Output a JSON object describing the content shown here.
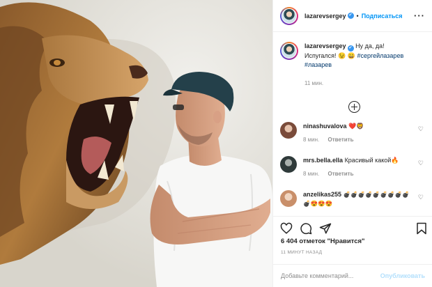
{
  "header": {
    "username": "lazarevsergey",
    "verified_mark": "✔",
    "separator": "•",
    "follow_label": "Подписаться",
    "more_label": "···"
  },
  "caption": {
    "username": "lazarevsergey",
    "text_line1": "Ну да, да!",
    "text_line2": "Испугался!",
    "emojis": "😉 😄",
    "hashtag1": "#сергейлазарев",
    "hashtag2": "#лазарев",
    "time": "11 мин."
  },
  "comments": [
    {
      "username": "ninashuvalova",
      "text": "❤️🦁",
      "time": "8 мин.",
      "reply_label": "Ответить",
      "avatar_color": "#7a4b3a"
    },
    {
      "username": "mrs.bella.ella",
      "text": "Красивый какой🔥",
      "time": "8 мин.",
      "reply_label": "Ответить",
      "avatar_color": "#2f3a3a"
    },
    {
      "username": "anzelikas255",
      "text": "💣💣💣💣💣💣💣💣💣💣😍😍😍",
      "avatar_color": "#c98f6a"
    }
  ],
  "actions": {
    "like_icon": "heart-icon",
    "comment_icon": "comment-icon",
    "share_icon": "share-icon",
    "save_icon": "bookmark-icon"
  },
  "likes_text": "6 404 отметок \"Нравится\"",
  "post_time": "11 МИНУТ НАЗАД",
  "add_comment": {
    "placeholder": "Добавьте комментарий...",
    "publish_label": "Опубликовать"
  },
  "colors": {
    "link_blue": "#0095f6",
    "hashtag": "#00376b",
    "muted": "#8e8e8e",
    "publish_disabled": "#b2dffc"
  }
}
